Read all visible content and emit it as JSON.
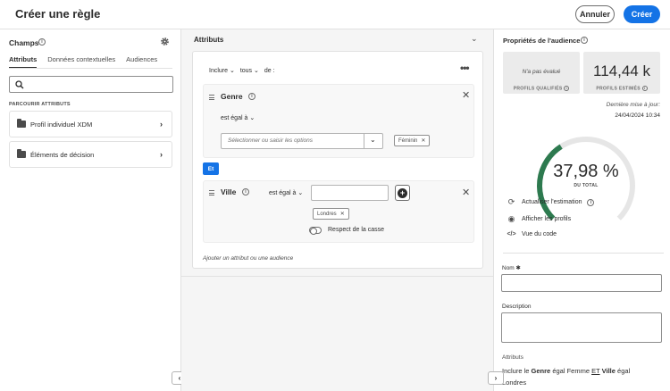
{
  "header": {
    "title": "Créer une règle",
    "cancel_label": "Annuler",
    "create_label": "Créer"
  },
  "left_panel": {
    "title": "Champs",
    "tabs": [
      {
        "label": "Attributs",
        "active": true
      },
      {
        "label": "Données contextuelles",
        "active": false
      },
      {
        "label": "Audiences",
        "active": false
      }
    ],
    "search": {
      "value": "",
      "placeholder": ""
    },
    "section_label": "PARCOURIR ATTRIBUTS",
    "items": [
      {
        "label": "Profil individuel XDM",
        "icon": "folder-icon"
      },
      {
        "label": "Éléments de décision",
        "icon": "folder-icon"
      }
    ]
  },
  "middle_panel": {
    "title": "Attributs",
    "rule": {
      "include": "Inclure",
      "quantifier": "tous",
      "of": "de :"
    },
    "genre_block": {
      "title": "Genre",
      "operator": "est égal à",
      "select_placeholder": "Sélectionner ou saisir les options",
      "tag": "Féminin"
    },
    "connector": "Et",
    "ville_block": {
      "title": "Ville",
      "operator": "est égal à",
      "input_value": "",
      "tag": "Londres",
      "case_label": "Respect de la casse"
    },
    "add_link": "Ajouter un attribut ou une audience"
  },
  "right_panel": {
    "title": "Propriétés de l'audience",
    "qualified": {
      "value": "N'a pas évalué",
      "caption": "PROFILS QUALIFIÉS"
    },
    "estimated": {
      "value": "114,44 k",
      "caption": "PROFILS ESTIMÉS"
    },
    "updated_label": "Dernière mise à jour:",
    "updated_value": "24/04/2024 10:34",
    "gauge": {
      "value_text": "37,98 %",
      "caption": "DU TOTAL",
      "percent": 37.98,
      "color": "#2d7a4f",
      "track": "#e6e6e6"
    },
    "actions": [
      {
        "label": "Actualiser l'estimation",
        "icon": "refresh-icon"
      },
      {
        "label": "Afficher les profils",
        "icon": "eye-icon"
      },
      {
        "label": "Vue du code",
        "icon": "code-icon"
      }
    ],
    "name_label": "Nom",
    "name_value": "",
    "description_label": "Description",
    "description_value": "",
    "attributes_label": "Attributs",
    "summary": {
      "w1": "Inclure le",
      "w2": "Genre",
      "w3": "égal Femme",
      "w4": "ET",
      "w5": "Ville",
      "w6": "égal",
      "w7": "Londres"
    }
  },
  "colors": {
    "accent": "#1473e6",
    "gauge": "#2d7a4f"
  }
}
